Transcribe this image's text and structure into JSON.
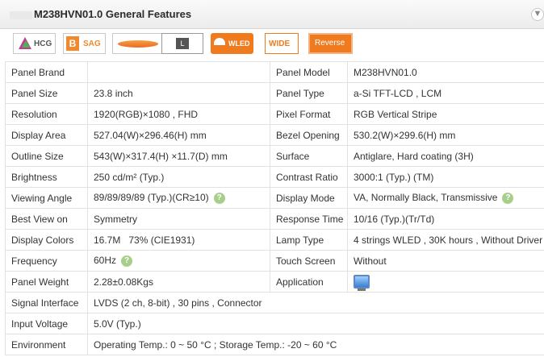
{
  "header": {
    "title": "M238HVN01.0 General Features",
    "expand_icon": "▼"
  },
  "badges": [
    {
      "name": "hcg",
      "label": "HCG"
    },
    {
      "name": "sag",
      "letter": "B",
      "label": "SAG"
    },
    {
      "name": "wide-view",
      "label": ""
    },
    {
      "name": "l",
      "label": "L"
    },
    {
      "name": "wled",
      "label": "WLED"
    },
    {
      "name": "wide",
      "label": "WIDE"
    },
    {
      "name": "reverse",
      "label": "Reverse"
    }
  ],
  "help_glyph": "?",
  "rows": [
    {
      "l1": "Panel Brand",
      "v1": "",
      "l2": "Panel Model",
      "v2": "M238HVN01.0"
    },
    {
      "l1": "Panel Size",
      "v1": "23.8 inch",
      "l2": "Panel Type",
      "v2": "a-Si TFT-LCD , LCM"
    },
    {
      "l1": "Resolution",
      "v1": "1920(RGB)×1080 , FHD",
      "l2": "Pixel Format",
      "v2": "RGB Vertical Stripe"
    },
    {
      "l1": "Display Area",
      "v1": "527.04(W)×296.46(H) mm",
      "l2": "Bezel Opening",
      "v2": "530.2(W)×299.6(H) mm"
    },
    {
      "l1": "Outline Size",
      "v1": "543(W)×317.4(H) ×11.7(D) mm",
      "l2": "Surface",
      "v2": "Antiglare, Hard coating (3H)"
    },
    {
      "l1": "Brightness",
      "v1": "250 cd/m² (Typ.)",
      "l2": "Contrast Ratio",
      "v2": "3000:1 (Typ.) (TM)"
    },
    {
      "l1": "Viewing Angle",
      "v1": "89/89/89/89 (Typ.)(CR≥10)",
      "l2": "Display Mode",
      "v2": "VA, Normally Black, Transmissive"
    },
    {
      "l1": "Best View on",
      "v1": "Symmetry",
      "l2": "Response Time",
      "v2": "10/16 (Typ.)(Tr/Td)"
    },
    {
      "l1": "Display Colors",
      "v1": "16.7M   73% (CIE1931)",
      "l2": "Lamp Type",
      "v2": "4 strings WLED , 30K hours , Without Driver"
    },
    {
      "l1": "Frequency",
      "v1": "60Hz",
      "l2": "Touch Screen",
      "v2": "Without"
    },
    {
      "l1": "Panel Weight",
      "v1": "2.28±0.08Kgs",
      "l2": "Application",
      "v2": ""
    },
    {
      "l1": "Signal Interface",
      "v1": "LVDS (2 ch, 8-bit) , 30 pins , Connector"
    },
    {
      "l1": "Input Voltage",
      "v1": "5.0V (Typ.)"
    },
    {
      "l1": "Environment",
      "v1": "Operating Temp.: 0 ~ 50 °C ; Storage Temp.: -20 ~ 60 °C"
    }
  ]
}
